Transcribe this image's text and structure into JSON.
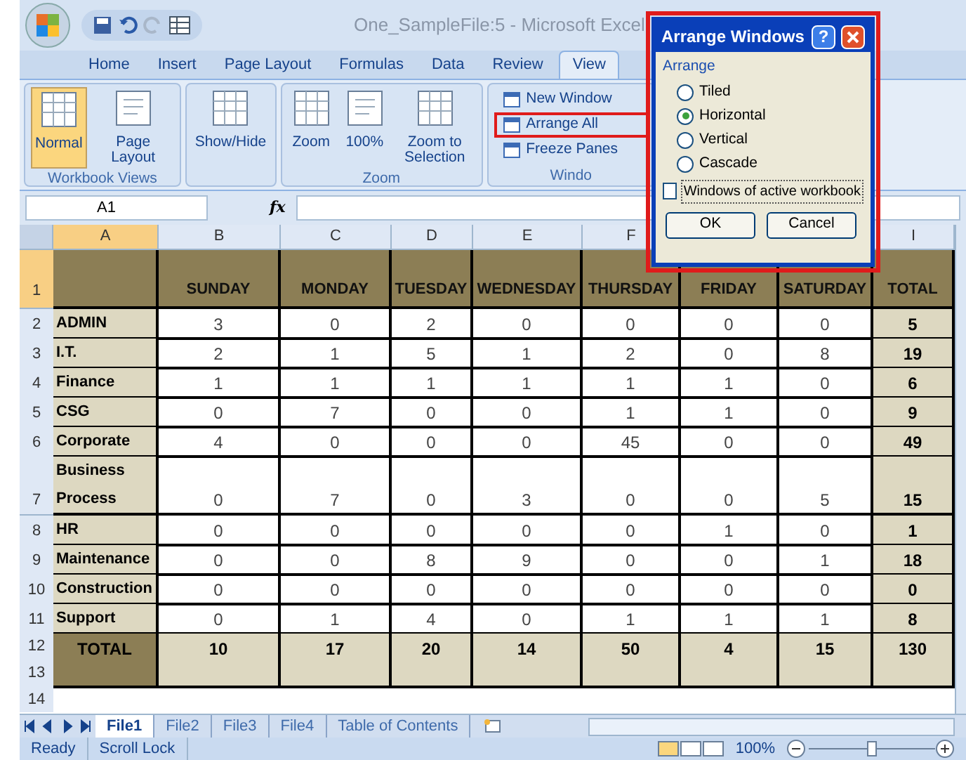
{
  "window": {
    "title": "One_SampleFile:5 - Microsoft Excel"
  },
  "ribbon_tabs": [
    {
      "label": "Home",
      "selected": false
    },
    {
      "label": "Insert",
      "selected": false
    },
    {
      "label": "Page Layout",
      "selected": false
    },
    {
      "label": "Formulas",
      "selected": false
    },
    {
      "label": "Data",
      "selected": false
    },
    {
      "label": "Review",
      "selected": false
    },
    {
      "label": "View",
      "selected": true
    }
  ],
  "ribbon_groups": [
    {
      "label": "Workbook Views",
      "buttons": [
        {
          "kind": "large",
          "label": "Normal",
          "selected": true
        },
        {
          "kind": "large",
          "label": "Page Layout",
          "selected": false
        }
      ]
    },
    {
      "buttons": [
        {
          "kind": "large",
          "label": "Show/Hide",
          "selected": false
        }
      ]
    },
    {
      "label": "Zoom",
      "buttons": [
        {
          "kind": "large",
          "label": "Zoom",
          "selected": false
        },
        {
          "kind": "large",
          "label": "100%",
          "selected": false
        },
        {
          "kind": "large",
          "label": "Zoom to Selection",
          "selected": false
        }
      ]
    },
    {
      "label": "Windo",
      "buttons": [
        {
          "kind": "small",
          "label": "New Window",
          "highlighted": false
        },
        {
          "kind": "small",
          "label": "Arrange All",
          "highlighted": true
        },
        {
          "kind": "small",
          "label": "Freeze Panes",
          "highlighted": false
        }
      ]
    }
  ],
  "formula_bar": {
    "name_box": "A1",
    "function_label": "fx"
  },
  "columns": [
    {
      "label": "A",
      "selected": true
    },
    {
      "label": "B",
      "selected": false
    },
    {
      "label": "C",
      "selected": false
    },
    {
      "label": "D",
      "selected": false
    },
    {
      "label": "E",
      "selected": false
    },
    {
      "label": "F",
      "selected": false
    },
    {
      "label": "I",
      "selected": false
    }
  ],
  "header_row": {
    "number": "1",
    "cells": [
      "SUNDAY",
      "MONDAY",
      "TUESDAY",
      "WEDNESDAY",
      "THURSDAY",
      "FRIDAY",
      "SATURDAY",
      "TOTAL"
    ]
  },
  "rows": [
    {
      "number": "2",
      "label": "ADMIN",
      "values": [
        "3",
        "0",
        "2",
        "0",
        "0",
        "0",
        "0"
      ],
      "total": "5"
    },
    {
      "number": "3",
      "label": "I.T.",
      "values": [
        "2",
        "1",
        "5",
        "1",
        "2",
        "0",
        "8"
      ],
      "total": "19"
    },
    {
      "number": "4",
      "label": "Finance",
      "values": [
        "1",
        "1",
        "1",
        "1",
        "1",
        "1",
        "0"
      ],
      "total": "6"
    },
    {
      "number": "5",
      "label": "CSG",
      "values": [
        "0",
        "7",
        "0",
        "0",
        "1",
        "1",
        "0"
      ],
      "total": "9"
    },
    {
      "number": "6",
      "label": "Corporate",
      "values": [
        "4",
        "0",
        "0",
        "0",
        "45",
        "0",
        "0"
      ],
      "total": "49"
    },
    {
      "number": "7",
      "label": "Business Process",
      "values": [
        "0",
        "7",
        "0",
        "3",
        "0",
        "0",
        "5"
      ],
      "total": "15"
    },
    {
      "number": "8",
      "label": "HR",
      "values": [
        "0",
        "0",
        "0",
        "0",
        "0",
        "1",
        "0"
      ],
      "total": "1"
    },
    {
      "number": "9",
      "label": "Maintenance",
      "values": [
        "0",
        "0",
        "8",
        "9",
        "0",
        "0",
        "1"
      ],
      "total": "18"
    },
    {
      "number": "10",
      "label": "Construction",
      "values": [
        "0",
        "0",
        "0",
        "0",
        "0",
        "0",
        "0"
      ],
      "total": "0"
    },
    {
      "number": "11",
      "label": "Support",
      "values": [
        "0",
        "1",
        "4",
        "0",
        "1",
        "1",
        "1"
      ],
      "total": "8"
    }
  ],
  "total_row": {
    "numbers": [
      "12",
      "13"
    ],
    "label": "TOTAL",
    "values": [
      "10",
      "17",
      "20",
      "14",
      "50",
      "4",
      "15"
    ],
    "total": "130"
  },
  "empty_rows": [
    "14"
  ],
  "sheet_tabs": [
    {
      "label": "File1",
      "selected": true
    },
    {
      "label": "File2",
      "selected": false
    },
    {
      "label": "File3",
      "selected": false
    },
    {
      "label": "File4",
      "selected": false
    },
    {
      "label": "Table of Contents",
      "selected": false
    }
  ],
  "status_bar": {
    "items": [
      "Ready",
      "Scroll Lock"
    ],
    "zoom": "100%",
    "zoom_slider": {
      "level": 0.5
    }
  },
  "dialog": {
    "title": "Arrange Windows",
    "help": "?",
    "group_label": "Arrange",
    "options": [
      {
        "label": "Tiled",
        "selected": false
      },
      {
        "label": "Horizontal",
        "selected": true
      },
      {
        "label": "Vertical",
        "selected": false
      },
      {
        "label": "Cascade",
        "selected": false
      }
    ],
    "checkbox": {
      "label": "Windows of active workbook",
      "checked": false
    },
    "buttons": [
      "OK",
      "Cancel"
    ]
  }
}
